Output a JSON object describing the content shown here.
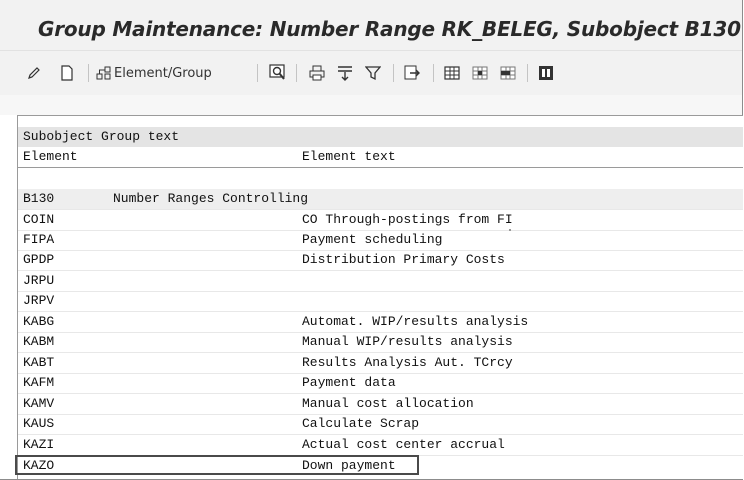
{
  "window": {
    "title": "Group Maintenance: Number Range RK_BELEG, Subobject B130"
  },
  "toolbar": {
    "items": [
      {
        "icon": "pencil-icon"
      },
      {
        "icon": "new-document-icon"
      },
      {
        "icon": "element-group-icon",
        "label": "Element/Group"
      },
      {
        "icon": "find-icon"
      },
      {
        "icon": "print-icon"
      },
      {
        "icon": "sort-icon"
      },
      {
        "icon": "filter-icon"
      },
      {
        "icon": "export-icon"
      },
      {
        "icon": "table-layout-icon"
      },
      {
        "icon": "insert-row-icon"
      },
      {
        "icon": "delete-row-icon"
      },
      {
        "icon": "info-icon"
      }
    ]
  },
  "table": {
    "header_row1": "Subobject Group text",
    "header_row2": {
      "col1": "Element",
      "col2": "Element text"
    },
    "group": {
      "id": "B130",
      "text": "Number Ranges Controlling"
    },
    "rows": [
      {
        "element": "COIN",
        "text": "CO Through-postings from FI"
      },
      {
        "element": "FIPA",
        "text": "Payment scheduling"
      },
      {
        "element": "GPDP",
        "text": "Distribution Primary Costs"
      },
      {
        "element": "JRPU",
        "text": ""
      },
      {
        "element": "JRPV",
        "text": ""
      },
      {
        "element": "KABG",
        "text": "Automat. WIP/results analysis"
      },
      {
        "element": "KABM",
        "text": "Manual WIP/results analysis"
      },
      {
        "element": "KABT",
        "text": "Results Analysis Aut. TCrcy"
      },
      {
        "element": "KAFM",
        "text": "Payment data"
      },
      {
        "element": "KAMV",
        "text": "Manual cost allocation"
      },
      {
        "element": "KAUS",
        "text": "Calculate Scrap"
      },
      {
        "element": "KAZI",
        "text": "Actual cost center accrual"
      },
      {
        "element": "KAZO",
        "text": "Down payment"
      }
    ]
  }
}
